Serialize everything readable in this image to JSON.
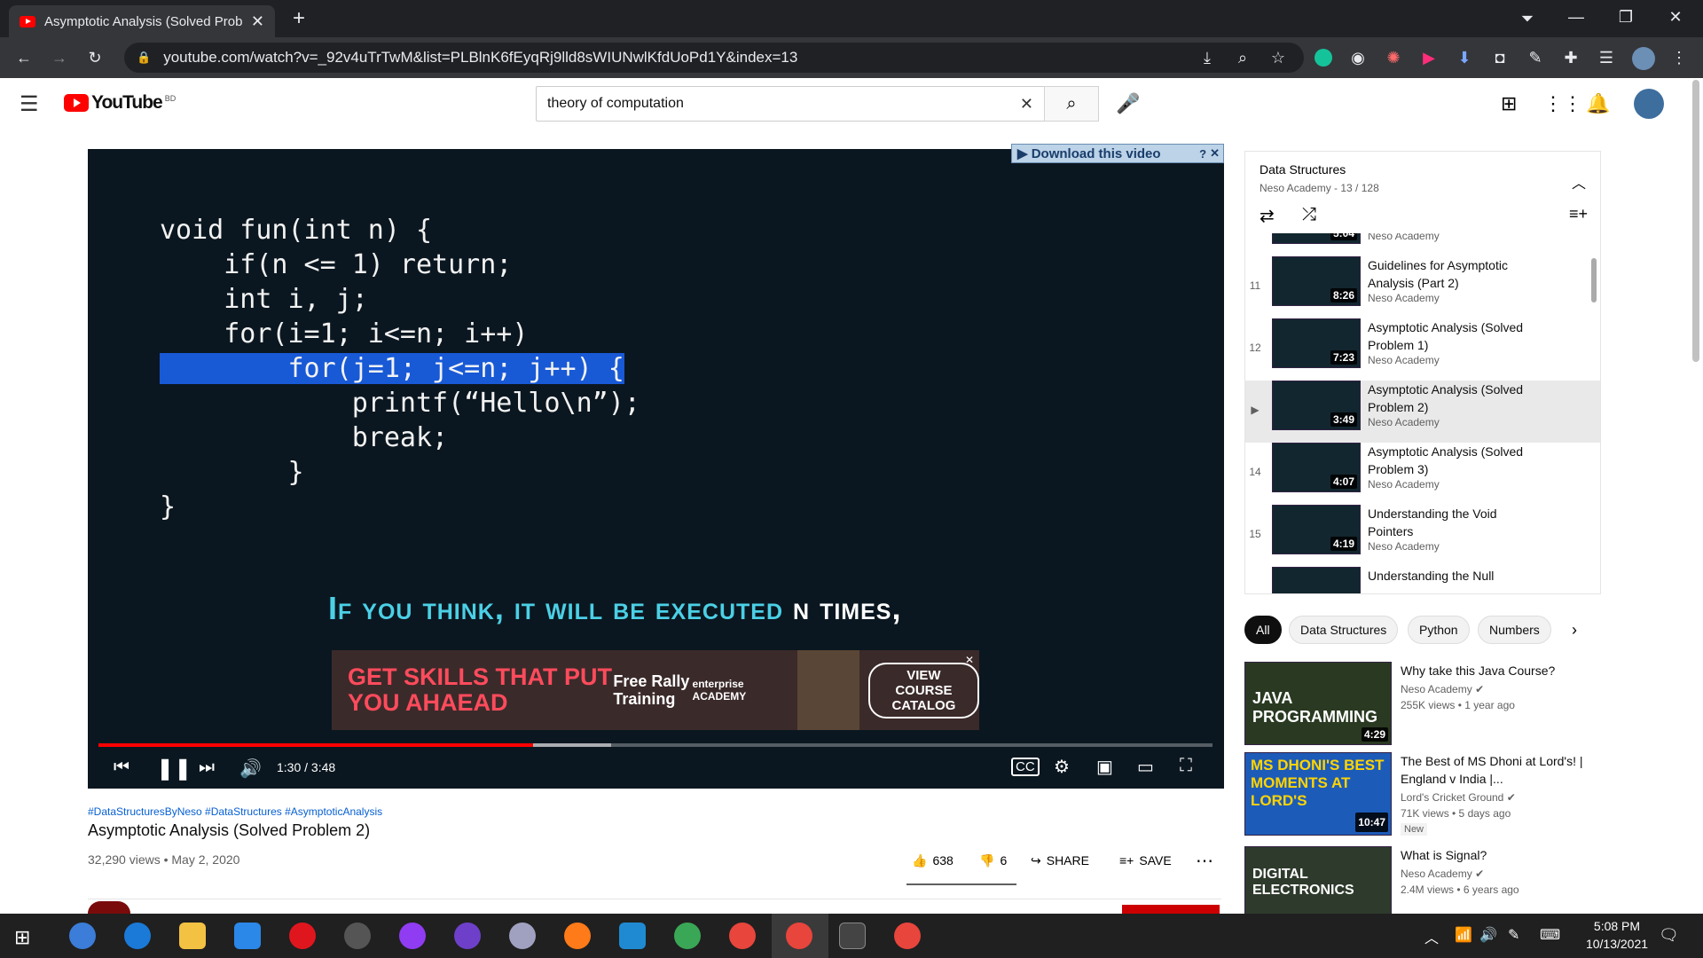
{
  "browser": {
    "tab_title": "Asymptotic Analysis (Solved Prob",
    "url": "youtube.com/watch?v=_92v4uTrTwM&list=PLBlnK6fEyqRj9lld8sWIUNwlKfdUoPd1Y&index=13"
  },
  "youtube": {
    "logo": "YouTube",
    "region": "BD",
    "search_value": "theory of computation"
  },
  "player": {
    "code_lines": [
      "void fun(int n) {",
      "    if(n <= 1) return;",
      "    int i, j;",
      "    for(i=1; i<=n; i++)",
      "        for(j=1; j<=n; j++) {",
      "            printf(“Hello\\n”);",
      "            break;",
      "        }",
      "}"
    ],
    "caption_cyan": "If you think, it will be executed",
    "caption_white": "n times,",
    "download_label": "▶ Download this video",
    "ad_text": "GET SKILLS THAT PUT YOU AHAEAD",
    "ad_offer": "Free Rally Training",
    "ad_brand": "enterprise ACADEMY",
    "ad_cta": "VIEW COURSE CATALOG",
    "time": "1:30 / 3:48",
    "played_fraction": 0.39,
    "buffered_fraction": 0.46
  },
  "video": {
    "hashtags": "#DataStructuresByNeso #DataStructures #AsymptoticAnalysis",
    "title": "Asymptotic Analysis (Solved Problem 2)",
    "meta": "32,290 views • May 2, 2020",
    "likes": "638",
    "dislikes": "6",
    "share": "SHARE",
    "save": "SAVE"
  },
  "playlist": {
    "title": "Data Structures",
    "subtitle": "Neso Academy - 13 / 128",
    "items": [
      {
        "index": "",
        "title": "",
        "channel": "Neso Academy",
        "duration": "5:04"
      },
      {
        "index": "11",
        "title": "Guidelines for Asymptotic Analysis (Part 2)",
        "channel": "Neso Academy",
        "duration": "8:26"
      },
      {
        "index": "12",
        "title": "Asymptotic Analysis (Solved Problem 1)",
        "channel": "Neso Academy",
        "duration": "7:23"
      },
      {
        "index": "▶",
        "title": "Asymptotic Analysis (Solved Problem 2)",
        "channel": "Neso Academy",
        "duration": "3:49"
      },
      {
        "index": "14",
        "title": "Asymptotic Analysis (Solved Problem 3)",
        "channel": "Neso Academy",
        "duration": "4:07"
      },
      {
        "index": "15",
        "title": "Understanding the Void Pointers",
        "channel": "Neso Academy",
        "duration": "4:19"
      },
      {
        "index": "",
        "title": "Understanding the Null",
        "channel": "",
        "duration": ""
      }
    ]
  },
  "chips": [
    "All",
    "Data Structures",
    "Python",
    "Numbers"
  ],
  "recommendations": [
    {
      "title": "Why take this Java Course?",
      "channel": "Neso Academy",
      "meta": "255K views • 1 year ago",
      "duration": "4:29",
      "thumb_text": "JAVA PROGRAMMING",
      "badge": ""
    },
    {
      "title": "The Best of MS Dhoni at Lord's! | England v India |...",
      "channel": "Lord's Cricket Ground",
      "meta": "71K views • 5 days ago",
      "duration": "10:47",
      "thumb_text": "MS DHONI'S BEST MOMENTS AT LORD'S",
      "badge": "New"
    },
    {
      "title": "What is Signal?",
      "channel": "Neso Academy",
      "meta": "2.4M views • 6 years ago",
      "duration": "",
      "thumb_text": "DIGITAL ELECTRONICS",
      "badge": ""
    }
  ],
  "taskbar": {
    "time": "5:08 PM",
    "date": "10/13/2021"
  }
}
